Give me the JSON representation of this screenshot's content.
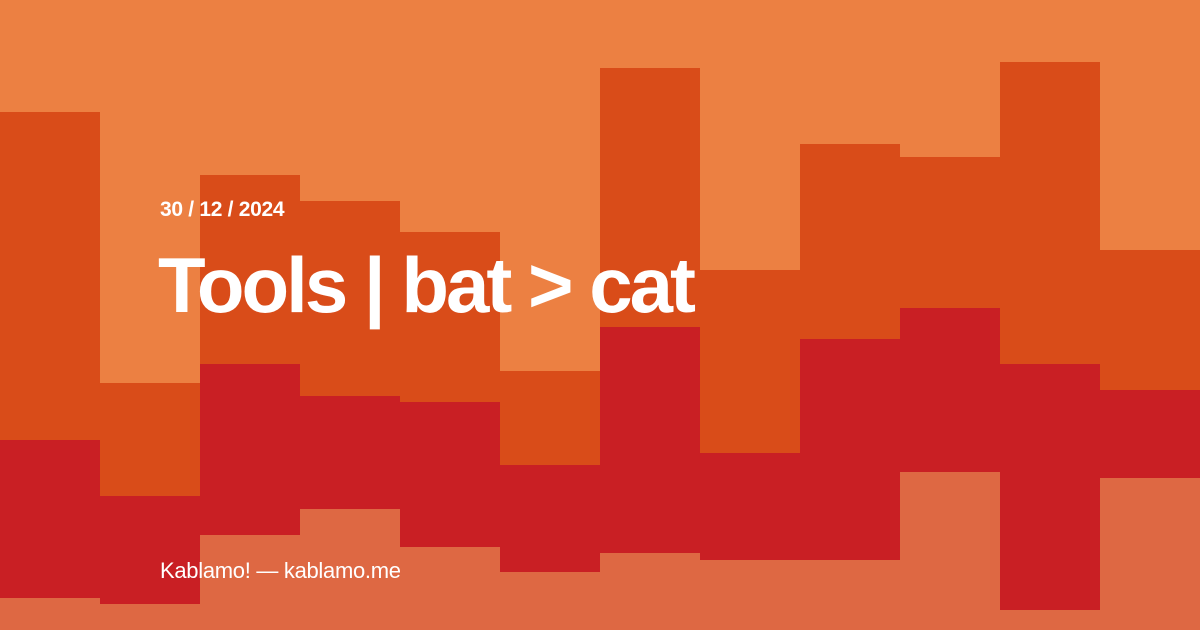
{
  "post": {
    "date": "30 / 12 / 2024",
    "title": "Tools | bat > cat",
    "footer": "Kablamo! — kablamo.me"
  },
  "colors": {
    "band_top": "#EC8042",
    "band_upper": "#D94C19",
    "band_middle": "#C91F24",
    "band_bottom": "#DE6843",
    "text": "#FFFFFF"
  }
}
